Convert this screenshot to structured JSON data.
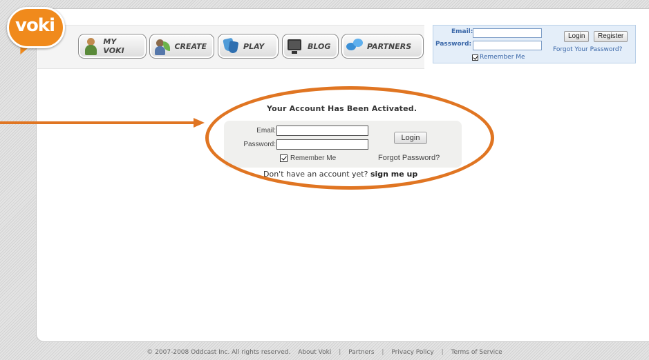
{
  "logo": {
    "text": "voki"
  },
  "nav": [
    {
      "label": "MY VOKI",
      "icon": "person-icon"
    },
    {
      "label": "CREATE",
      "icon": "create-icon"
    },
    {
      "label": "PLAY",
      "icon": "masks-icon"
    },
    {
      "label": "BLOG",
      "icon": "monitor-icon"
    },
    {
      "label": "PARTNERS",
      "icon": "speech-bubbles-icon"
    }
  ],
  "top_login": {
    "email_label": "Email:",
    "password_label": "Password:",
    "email_value": "",
    "password_value": "",
    "login_button": "Login",
    "register_button": "Register",
    "forgot": "Forgot Your Password?",
    "remember": "Remember Me"
  },
  "main": {
    "title": "Your Account Has Been Activated.",
    "email_label": "Email:",
    "password_label": "Password:",
    "email_value": "",
    "password_value": "",
    "login_button": "Login",
    "remember": "Remember Me",
    "forgot": "Forgot Password?",
    "signup_prefix": "Don't have an account yet?",
    "signup_link": "sign me up"
  },
  "footer": {
    "copyright": "© 2007-2008 Oddcast Inc. All rights reserved.",
    "links": [
      "About Voki",
      "Partners",
      "Privacy Policy",
      "Terms of Service"
    ],
    "separator": "|"
  },
  "colors": {
    "brand_orange": "#f08a1c",
    "annotation_orange": "#e07522",
    "link_blue": "#3a67a8"
  }
}
